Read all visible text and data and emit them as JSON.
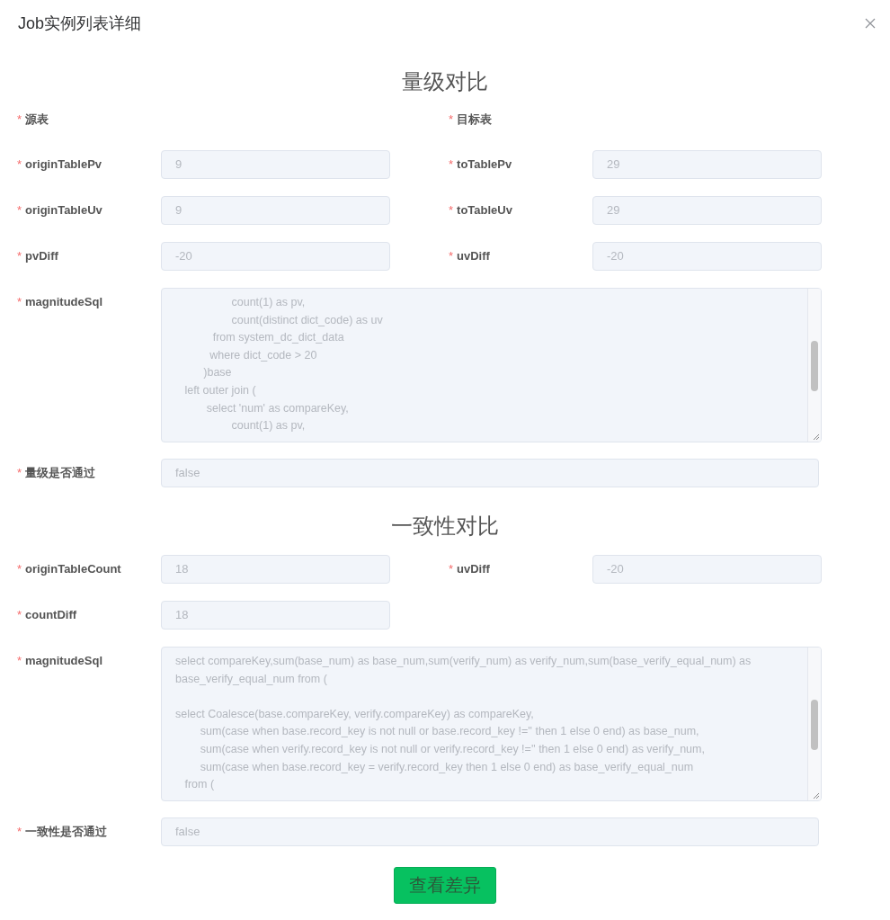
{
  "dialog": {
    "title": "Job实例列表详细"
  },
  "sections": [
    {
      "heading": "量级对比",
      "rows": [
        {
          "kind": "labels",
          "fields": [
            {
              "label": "源表",
              "required_mark": "*"
            },
            {
              "label": "目标表",
              "required_mark": "*"
            }
          ]
        },
        {
          "kind": "pair",
          "fields": [
            {
              "label": "originTablePv",
              "required_mark": "*",
              "value": "9"
            },
            {
              "label": "toTablePv",
              "required_mark": "*",
              "value": "29"
            }
          ]
        },
        {
          "kind": "pair",
          "fields": [
            {
              "label": "originTableUv",
              "required_mark": "*",
              "value": "9"
            },
            {
              "label": "toTableUv",
              "required_mark": "*",
              "value": "29"
            }
          ]
        },
        {
          "kind": "pair",
          "fields": [
            {
              "label": "pvDiff",
              "required_mark": "*",
              "value": "-20"
            },
            {
              "label": "uvDiff",
              "required_mark": "*",
              "value": "-20"
            }
          ]
        },
        {
          "kind": "textarea",
          "fields": [
            {
              "label": "magnitudeSql",
              "required_mark": "*",
              "value": "                  count(1) as pv,\n                  count(distinct dict_code) as uv\n            from system_dc_dict_data\n           where dict_code > 20\n         )base\n   left outer join (\n          select 'num' as compareKey,\n                  count(1) as pv,"
            }
          ]
        },
        {
          "kind": "wide",
          "fields": [
            {
              "label": "量级是否通过",
              "required_mark": "*",
              "value": "false"
            }
          ]
        }
      ]
    },
    {
      "heading": "一致性对比",
      "rows": [
        {
          "kind": "pair",
          "fields": [
            {
              "label": "originTableCount",
              "required_mark": "*",
              "value": "18"
            },
            {
              "label": "uvDiff",
              "required_mark": "*",
              "value": "-20"
            }
          ]
        },
        {
          "kind": "pair",
          "fields": [
            {
              "label": "countDiff",
              "required_mark": "*",
              "value": "18"
            }
          ]
        },
        {
          "kind": "textarea",
          "fields": [
            {
              "label": "magnitudeSql",
              "required_mark": "*",
              "value": "select compareKey,sum(base_num) as base_num,sum(verify_num) as verify_num,sum(base_verify_equal_num) as base_verify_equal_num from (\n\nselect Coalesce(base.compareKey, verify.compareKey) as compareKey,\n        sum(case when base.record_key is not null or base.record_key !='' then 1 else 0 end) as base_num,\n        sum(case when verify.record_key is not null or verify.record_key !='' then 1 else 0 end) as verify_num,\n        sum(case when base.record_key = verify.record_key then 1 else 0 end) as base_verify_equal_num\n   from ("
            }
          ]
        },
        {
          "kind": "wide",
          "fields": [
            {
              "label": "一致性是否通过",
              "required_mark": "*",
              "value": "false"
            }
          ]
        }
      ]
    }
  ],
  "button": {
    "label": "查看差异"
  }
}
